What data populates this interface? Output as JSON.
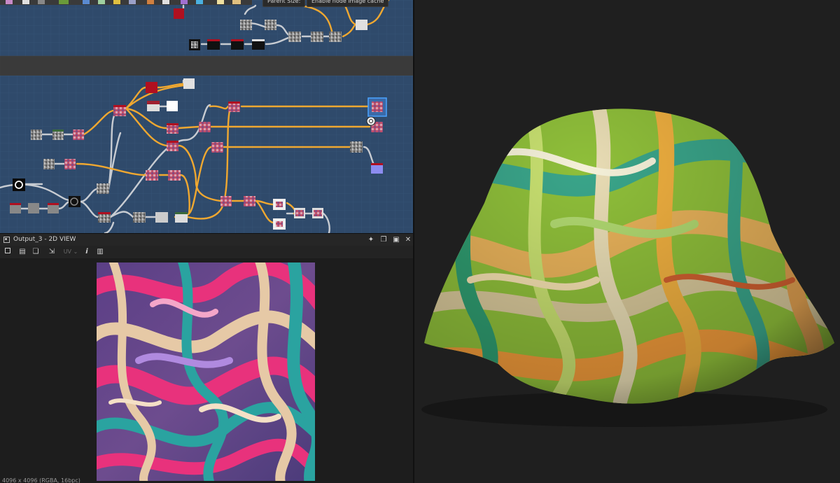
{
  "app": {
    "top_tabs": [
      "Parent Size:",
      "Enable node image cache"
    ]
  },
  "view2d": {
    "title": "Output_3 - 2D VIEW",
    "uv_label": "UV",
    "info_label": "i",
    "status": "4096 x 4096 (RGBA, 16bpc)",
    "icons": [
      "viewport-icon",
      "save-icon",
      "copy-icon",
      "export-icon",
      "uv-dropdown",
      "info-icon",
      "histogram-icon"
    ],
    "window_buttons": [
      "pin-icon",
      "float-icon",
      "maximize-icon",
      "close-icon"
    ]
  },
  "colors": {
    "graph_bg": "#2f4a6b",
    "grid_line": "#3b5a80",
    "frame_bg": "#3a3a3a",
    "wire_orange": "#f0a830",
    "wire_gray": "#c8ccd2",
    "selection": "#4aa3ff"
  }
}
